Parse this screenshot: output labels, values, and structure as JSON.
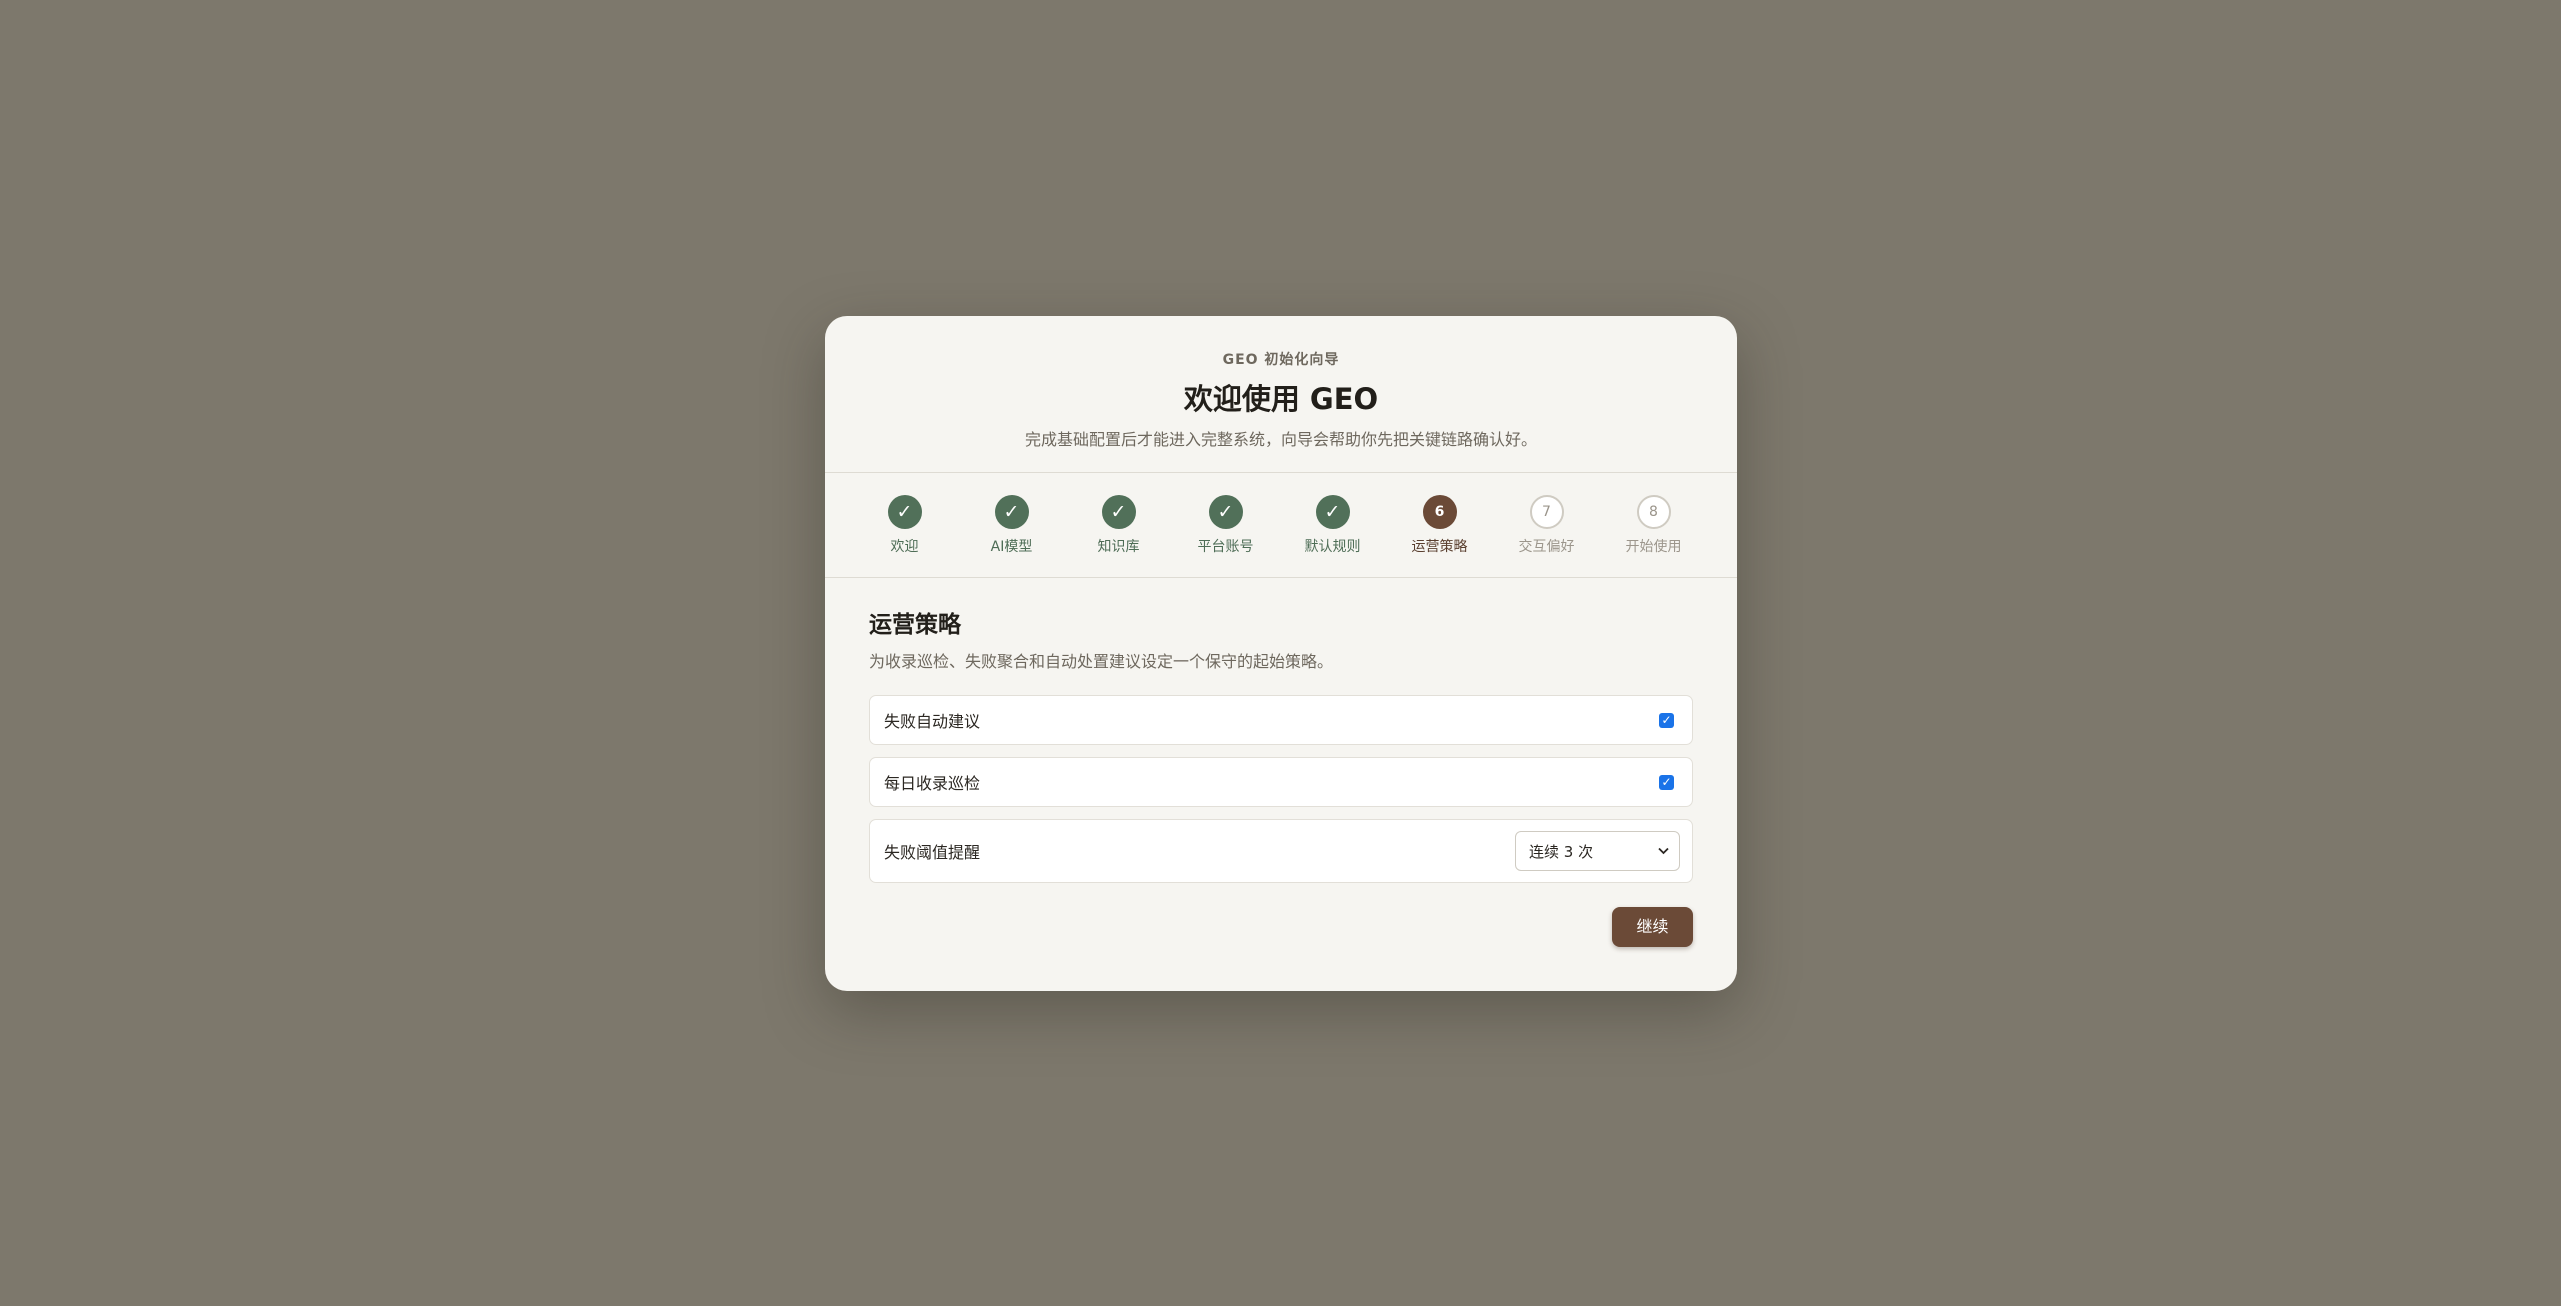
{
  "header": {
    "eyebrow": "GEO 初始化向导",
    "title": "欢迎使用 GEO",
    "subtitle": "完成基础配置后才能进入完整系统，向导会帮助你先把关键链路确认好。"
  },
  "steps": [
    {
      "number": "1",
      "label": "欢迎",
      "status": "done",
      "mark": "✓"
    },
    {
      "number": "2",
      "label": "AI模型",
      "status": "done",
      "mark": "✓"
    },
    {
      "number": "3",
      "label": "知识库",
      "status": "done",
      "mark": "✓"
    },
    {
      "number": "4",
      "label": "平台账号",
      "status": "done",
      "mark": "✓"
    },
    {
      "number": "5",
      "label": "默认规则",
      "status": "done",
      "mark": "✓"
    },
    {
      "number": "6",
      "label": "运营策略",
      "status": "active",
      "mark": "6"
    },
    {
      "number": "7",
      "label": "交互偏好",
      "status": "pending",
      "mark": "7"
    },
    {
      "number": "8",
      "label": "开始使用",
      "status": "pending",
      "mark": "8"
    }
  ],
  "section": {
    "title": "运营策略",
    "description": "为收录巡检、失败聚合和自动处置建议设定一个保守的起始策略。"
  },
  "options": {
    "auto_suggest": {
      "label": "失败自动建议",
      "checked": true
    },
    "daily_check": {
      "label": "每日收录巡检",
      "checked": true
    },
    "threshold": {
      "label": "失败阈值提醒",
      "selected": "连续 3 次"
    }
  },
  "footer": {
    "continue_label": "继续"
  },
  "colors": {
    "backdrop": "#7d786c",
    "done": "#517059",
    "active": "#6b4a37",
    "checkbox": "#1a73e8"
  }
}
